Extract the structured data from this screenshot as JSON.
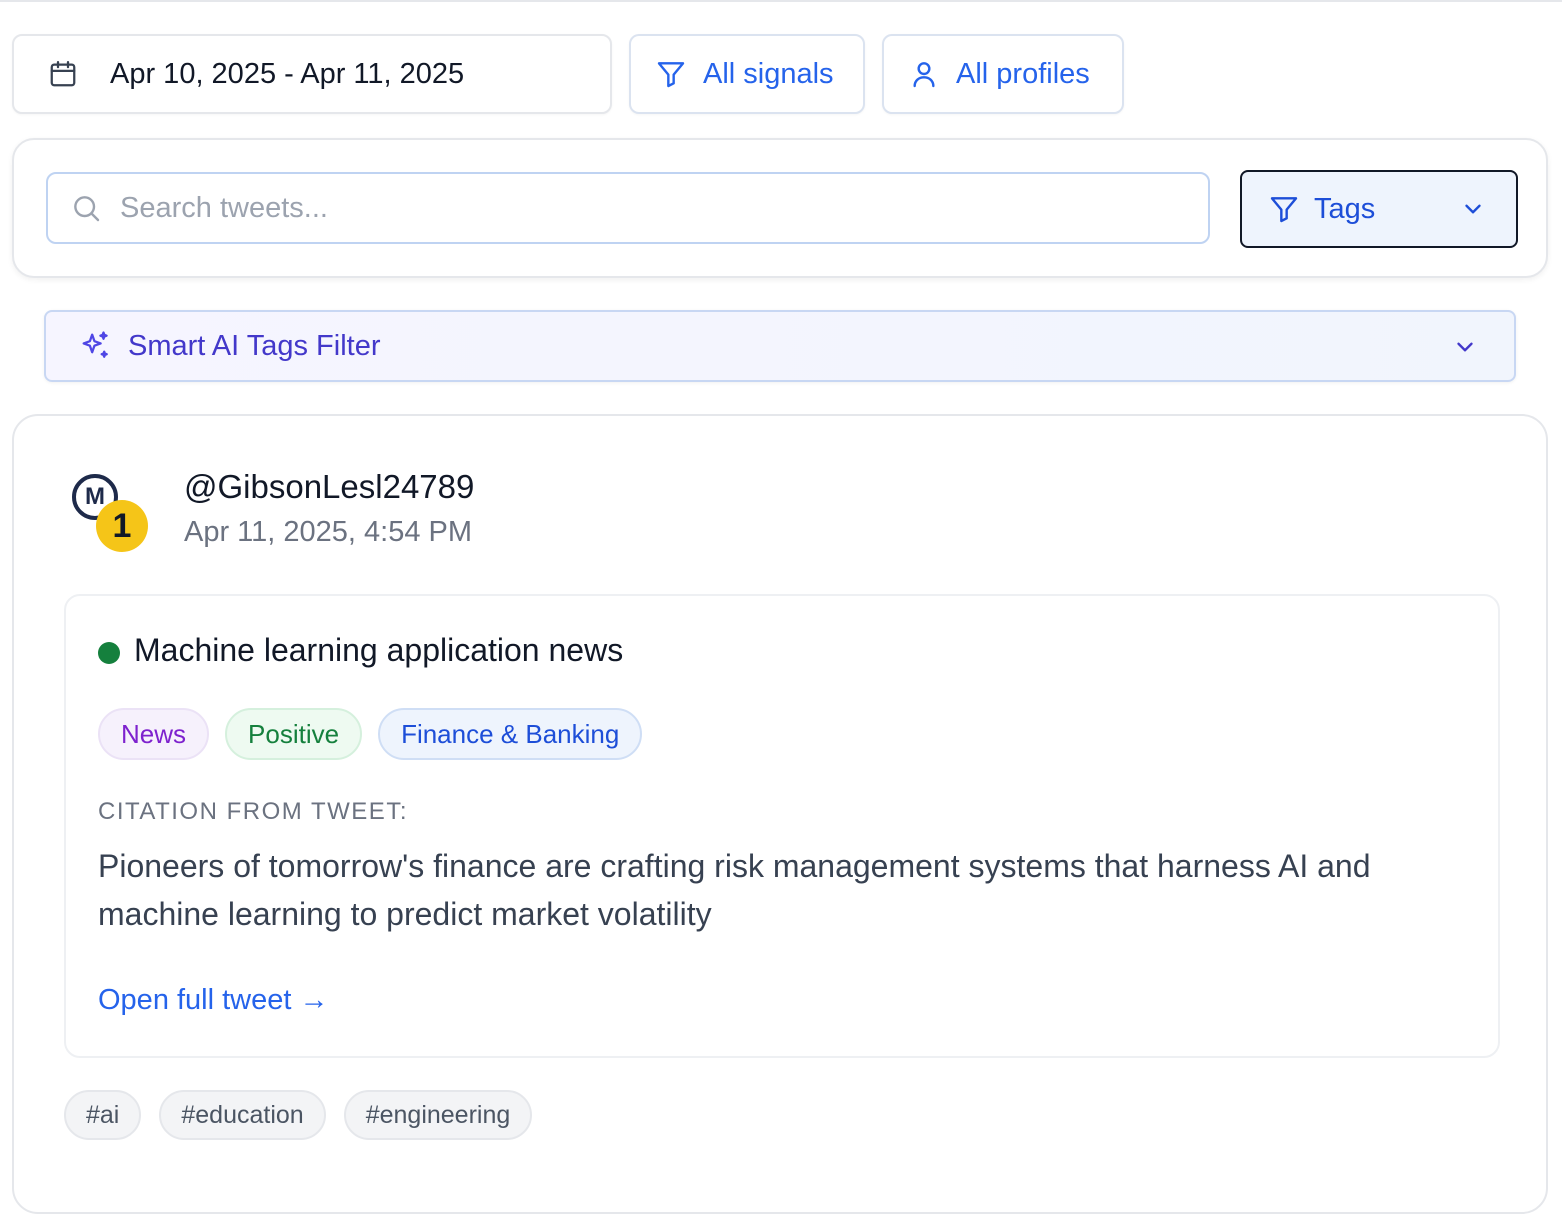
{
  "filters": {
    "date_range": "Apr 10, 2025 - Apr 11, 2025",
    "signals_label": "All signals",
    "profiles_label": "All profiles"
  },
  "search": {
    "placeholder": "Search tweets...",
    "value": "",
    "tags_label": "Tags"
  },
  "smart_ai": {
    "label": "Smart AI Tags Filter"
  },
  "tweet": {
    "avatar_letter": "M",
    "avatar_badge": "1",
    "handle": "@GibsonLesl24789",
    "timestamp": "Apr 11, 2025, 4:54 PM",
    "signal": {
      "title": "Machine learning application news",
      "status_color": "#15803d",
      "tags": [
        "News",
        "Positive",
        "Finance & Banking"
      ],
      "citation_label": "CITATION FROM TWEET:",
      "citation_text": "Pioneers of tomorrow's finance are crafting risk management systems that harness AI and machine learning to predict market volatility",
      "open_link": "Open full tweet →"
    },
    "hashtags": [
      "#ai",
      "#education",
      "#engineering"
    ]
  },
  "colors": {
    "accent": "#2563eb",
    "ai_accent": "#4338ca"
  },
  "icons": {
    "date": "calendar-icon",
    "signals": "filter-icon",
    "profiles": "user-icon",
    "search": "search-icon",
    "tags": "filter-icon",
    "smart_ai": "sparkles-icon",
    "chevron": "chevron-down-icon"
  }
}
